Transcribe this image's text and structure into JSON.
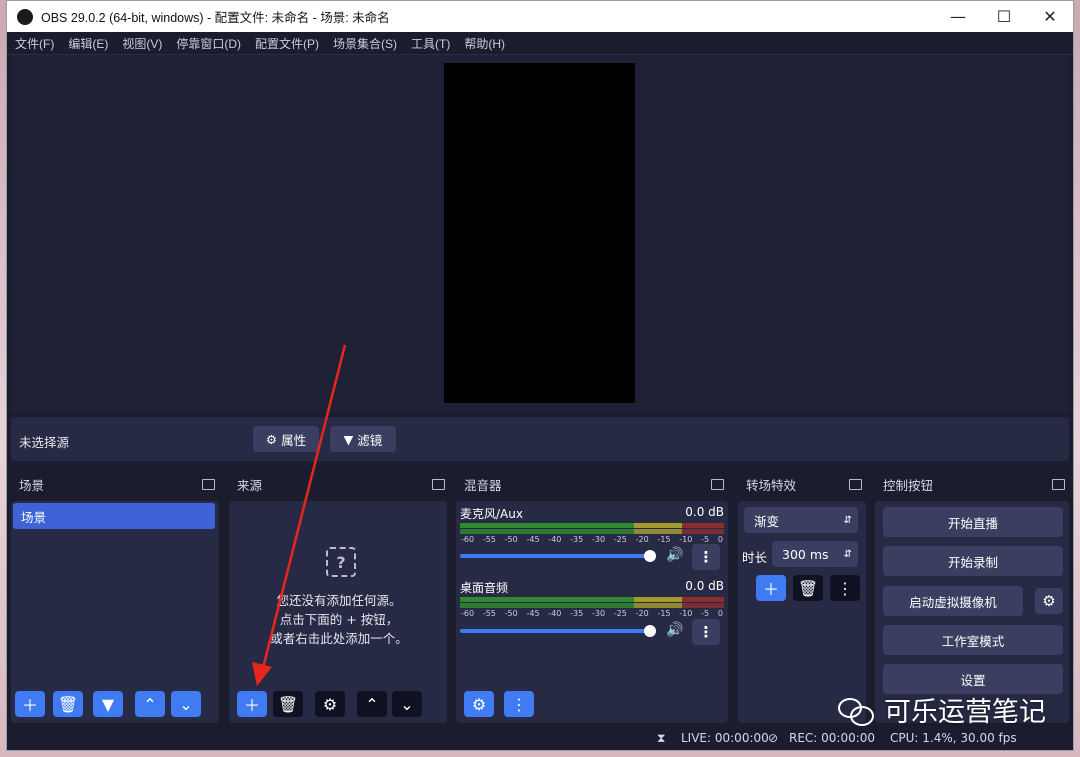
{
  "window": {
    "title": "OBS 29.0.2 (64-bit, windows) - 配置文件: 未命名 - 场景: 未命名"
  },
  "menu": [
    "文件(F)",
    "编辑(E)",
    "视图(V)",
    "停靠窗口(D)",
    "配置文件(P)",
    "场景集合(S)",
    "工具(T)",
    "帮助(H)"
  ],
  "source_bar": {
    "no_selection": "未选择源",
    "properties": "属性",
    "filters": "滤镜"
  },
  "scenes": {
    "title": "场景",
    "items": [
      "场景"
    ]
  },
  "sources": {
    "title": "来源",
    "empty_line1": "您还没有添加任何源。",
    "empty_line2": "点击下面的 + 按钮，",
    "empty_line3": "或者右击此处添加一个。"
  },
  "mixer": {
    "title": "混音器",
    "ticks": [
      "-60",
      "-55",
      "-50",
      "-45",
      "-40",
      "-35",
      "-30",
      "-25",
      "-20",
      "-15",
      "-10",
      "-5",
      "0"
    ],
    "channels": [
      {
        "name": "麦克风/Aux",
        "db": "0.0 dB",
        "volume": 1.0
      },
      {
        "name": "桌面音频",
        "db": "0.0 dB",
        "volume": 1.0
      }
    ]
  },
  "transitions": {
    "title": "转场特效",
    "selected": "渐变",
    "duration_label": "时长",
    "duration_value": "300 ms"
  },
  "controls": {
    "title": "控制按钮",
    "start_streaming": "开始直播",
    "start_recording": "开始录制",
    "start_virtual_cam": "启动虚拟摄像机",
    "studio_mode": "工作室模式",
    "settings": "设置"
  },
  "status": {
    "live": "LIVE: 00:00:00",
    "rec": "REC: 00:00:00",
    "cpu": "CPU: 1.4%, 30.00 fps"
  },
  "watermark": {
    "text": "可乐运营笔记"
  },
  "colors": {
    "accent": "#3f7bf2",
    "panel": "#272a45",
    "bg": "#1b1d2e",
    "arrow": "#e8261c"
  }
}
